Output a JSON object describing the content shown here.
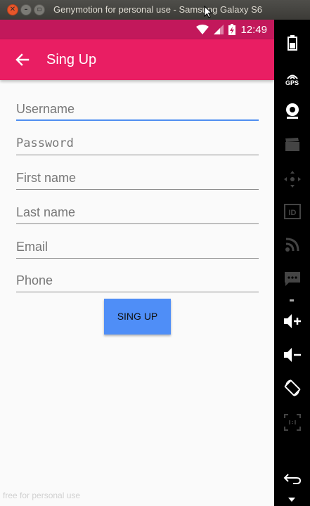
{
  "window": {
    "title": "Genymotion for personal use - Samsung Galaxy S6"
  },
  "status_bar": {
    "time": "12:49"
  },
  "app_bar": {
    "title": "Sing Up"
  },
  "form": {
    "fields": [
      {
        "placeholder": "Username"
      },
      {
        "placeholder": "Password"
      },
      {
        "placeholder": "First name"
      },
      {
        "placeholder": "Last name"
      },
      {
        "placeholder": "Email"
      },
      {
        "placeholder": "Phone"
      }
    ],
    "submit_label": "SING UP"
  },
  "watermark": "free for personal use",
  "sidebar": {
    "gps_label": "GPS",
    "id_label": "ID"
  },
  "colors": {
    "status_bar": "#c2185b",
    "app_bar": "#e91e63",
    "focus_underline": "#4f8ef0",
    "button": "#4f8ef7"
  }
}
